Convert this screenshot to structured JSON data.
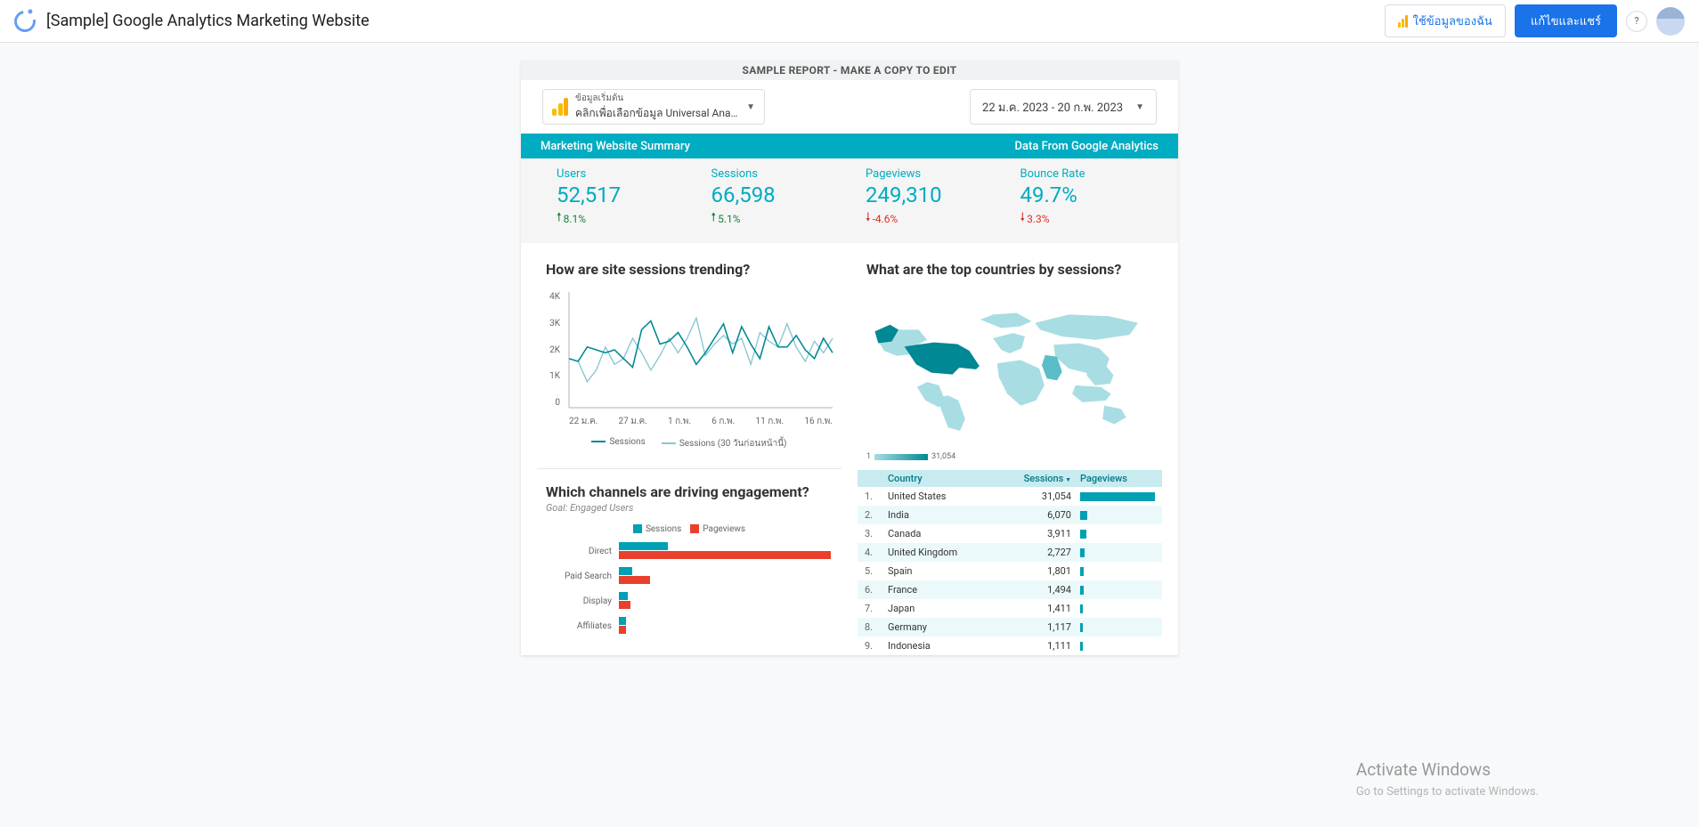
{
  "title": "[Sample] Google Analytics Marketing Website",
  "header": {
    "use_my_data": "ใช้ข้อมูลของฉัน",
    "edit_share": "แก้ไขและแชร์",
    "help": "?"
  },
  "banner": "SAMPLE REPORT - MAKE A COPY TO EDIT",
  "source_picker": {
    "label": "ข้อมูลเริ่มต้น",
    "value": "คลิกเพื่อเลือกข้อมูล Universal Analytics"
  },
  "date_range": "22 ม.ค. 2023 - 20 ก.พ. 2023",
  "strip": {
    "left": "Marketing Website Summary",
    "right": "Data From Google Analytics"
  },
  "kpis": [
    {
      "label": "Users",
      "value": "52,517",
      "change": "8.1%",
      "dir": "up"
    },
    {
      "label": "Sessions",
      "value": "66,598",
      "change": "5.1%",
      "dir": "up"
    },
    {
      "label": "Pageviews",
      "value": "249,310",
      "change": "-4.6%",
      "dir": "down"
    },
    {
      "label": "Bounce Rate",
      "value": "49.7%",
      "change": "3.3%",
      "dir": "down"
    }
  ],
  "trend": {
    "title": "How are site sessions trending?",
    "legend": [
      "Sessions",
      "Sessions (30 วันก่อนหน้านี้)"
    ]
  },
  "countries": {
    "title": "What are the top countries by sessions?",
    "scale_min": "1",
    "scale_max": "31,054",
    "columns": {
      "country": "Country",
      "sessions": "Sessions",
      "pageviews": "Pageviews"
    },
    "rows": [
      {
        "n": "1.",
        "country": "United States",
        "sessions": "31,054",
        "bar": 100
      },
      {
        "n": "2.",
        "country": "India",
        "sessions": "6,070",
        "bar": 10
      },
      {
        "n": "3.",
        "country": "Canada",
        "sessions": "3,911",
        "bar": 8
      },
      {
        "n": "4.",
        "country": "United Kingdom",
        "sessions": "2,727",
        "bar": 6
      },
      {
        "n": "5.",
        "country": "Spain",
        "sessions": "1,801",
        "bar": 5
      },
      {
        "n": "6.",
        "country": "France",
        "sessions": "1,494",
        "bar": 5
      },
      {
        "n": "7.",
        "country": "Japan",
        "sessions": "1,411",
        "bar": 4
      },
      {
        "n": "8.",
        "country": "Germany",
        "sessions": "1,117",
        "bar": 4
      },
      {
        "n": "9.",
        "country": "Indonesia",
        "sessions": "1,111",
        "bar": 4
      }
    ]
  },
  "channels": {
    "title": "Which channels are driving engagement?",
    "subtitle": "Goal: Engaged Users",
    "legend": [
      "Sessions",
      "Pageviews"
    ],
    "rows": [
      {
        "label": "Direct",
        "sessions": 22,
        "pageviews": 95
      },
      {
        "label": "Paid Search",
        "sessions": 6,
        "pageviews": 14
      },
      {
        "label": "Display",
        "sessions": 4,
        "pageviews": 5
      },
      {
        "label": "Affiliates",
        "sessions": 3,
        "pageviews": 3
      }
    ]
  },
  "chart_data": [
    {
      "type": "line",
      "title": "How are site sessions trending?",
      "xlabel": "",
      "ylabel": "",
      "ylim": [
        0,
        4000
      ],
      "yticks": [
        "0",
        "1K",
        "2K",
        "3K",
        "4K"
      ],
      "categories": [
        "22 ม.ค.",
        "27 ม.ค.",
        "1 ก.พ.",
        "6 ก.พ.",
        "11 ก.พ.",
        "16 ก.พ."
      ],
      "series": [
        {
          "name": "Sessions",
          "values": [
            1700,
            1600,
            2100,
            2000,
            1900,
            2000,
            1700,
            1400,
            2700,
            3000,
            2200,
            2300,
            2600,
            2100,
            1500,
            1900,
            2400,
            2900,
            1900,
            2800,
            2200,
            1700,
            2800,
            2100,
            2100,
            2500,
            2000,
            1700,
            2400,
            1900
          ]
        },
        {
          "name": "Sessions (30 วันก่อนหน้านี้)",
          "values": [
            1700,
            1600,
            900,
            1300,
            2100,
            1500,
            1700,
            2400,
            1900,
            1300,
            1800,
            2400,
            1900,
            2400,
            3100,
            1800,
            2200,
            2500,
            2200,
            2400,
            1500,
            2600,
            2300,
            2100,
            2900,
            2100,
            1600,
            2300,
            1900,
            2400
          ]
        }
      ]
    },
    {
      "type": "bar",
      "title": "What are the top countries by sessions?",
      "categories": [
        "United States",
        "India",
        "Canada",
        "United Kingdom",
        "Spain",
        "France",
        "Japan",
        "Germany",
        "Indonesia"
      ],
      "series": [
        {
          "name": "Sessions",
          "values": [
            31054,
            6070,
            3911,
            2727,
            1801,
            1494,
            1411,
            1117,
            1111
          ]
        }
      ]
    },
    {
      "type": "bar",
      "orientation": "horizontal",
      "title": "Which channels are driving engagement?",
      "categories": [
        "Direct",
        "Paid Search",
        "Display",
        "Affiliates"
      ],
      "series": [
        {
          "name": "Sessions",
          "values": [
            22,
            6,
            4,
            3
          ]
        },
        {
          "name": "Pageviews",
          "values": [
            95,
            14,
            5,
            3
          ]
        }
      ]
    }
  ],
  "watermark": {
    "heading": "Activate Windows",
    "sub": "Go to Settings to activate Windows."
  }
}
